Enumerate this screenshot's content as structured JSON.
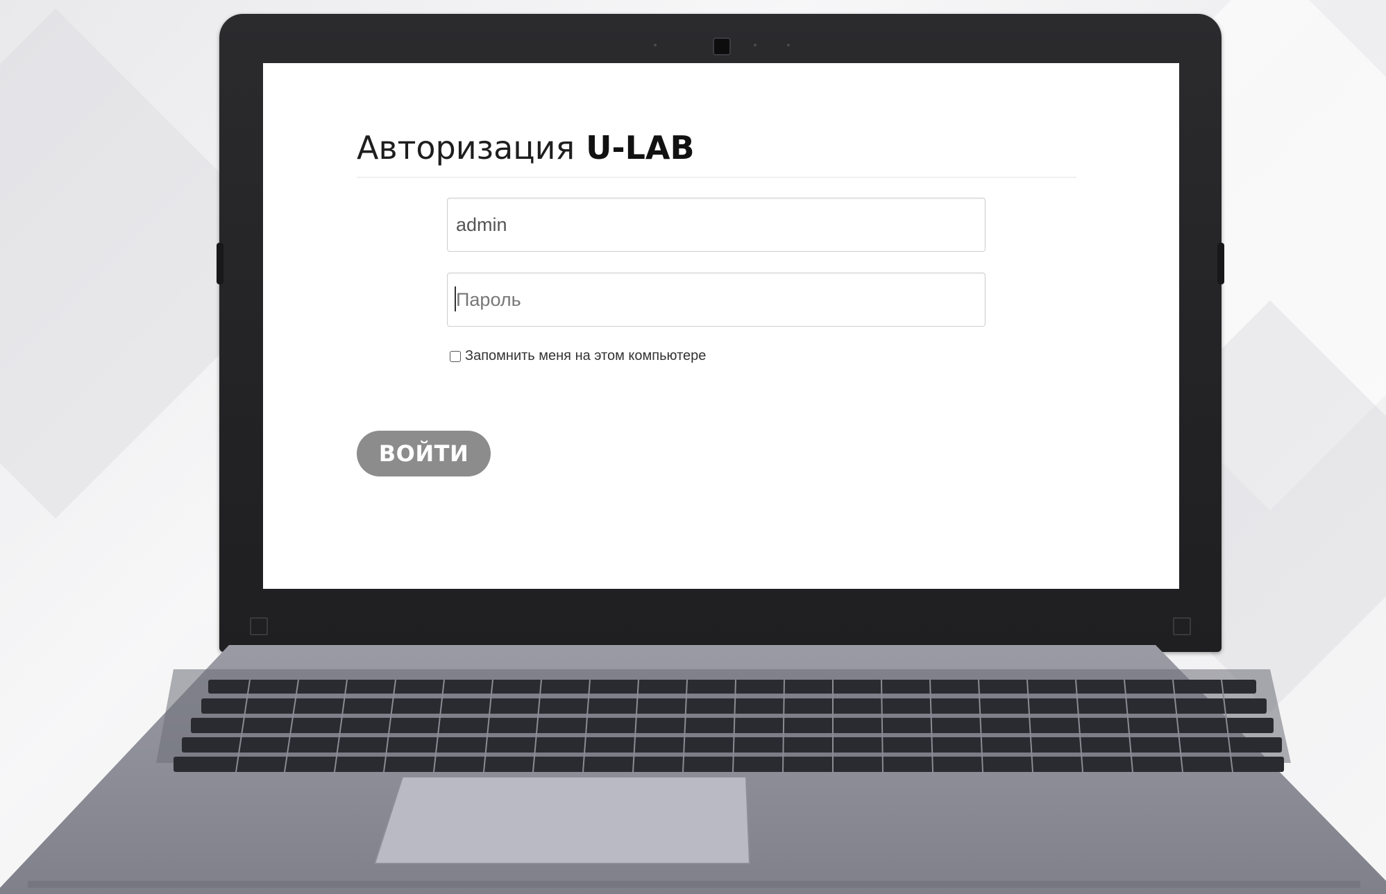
{
  "page": {
    "title_prefix": "Авторизация",
    "brand": "U-LAB"
  },
  "form": {
    "login_value": "admin",
    "password_placeholder": "Пароль",
    "remember_label": "Запомнить меня на этом компьютере",
    "remember_checked": false,
    "submit_label": "ВОЙТИ"
  },
  "colors": {
    "button_bg": "#8c8c8c",
    "screen_bg": "#ffffff",
    "lid": "#232325",
    "deck": "#8e8f98"
  },
  "icons": {
    "camera": "webcam-icon",
    "checkbox": "checkbox-icon"
  }
}
